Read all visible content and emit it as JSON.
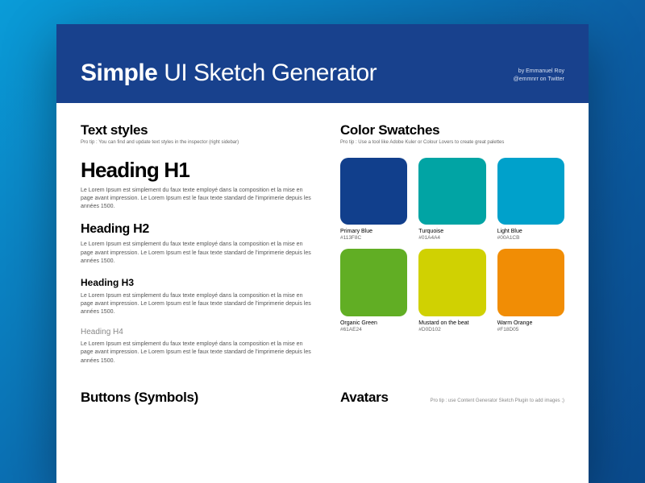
{
  "header": {
    "title_bold": "Simple",
    "title_rest": " UI Sketch Generator",
    "credit_line1": "by Emmanuel Roy",
    "credit_line2": "@emmnrr on Twitter"
  },
  "text_styles": {
    "title": "Text styles",
    "protip": "Pro tip : You can find and update text styles in the inspector (right sidebar)",
    "h1": "Heading H1",
    "h2": "Heading H2",
    "h3": "Heading H3",
    "h4": "Heading H4",
    "body": "Le Lorem Ipsum est simplement du faux texte employé dans la composition et la mise en page avant impression. Le Lorem Ipsum est le faux texte standard de l'imprimerie depuis les années 1500."
  },
  "color_swatches": {
    "title": "Color Swatches",
    "protip": "Pro tip : Use a tool like Adobe Kuler or Colour Lovers to create great palettes",
    "items": [
      {
        "name": "Primary Blue",
        "hex": "#113F8C"
      },
      {
        "name": "Turquoise",
        "hex": "#01A4A4"
      },
      {
        "name": "Light Blue",
        "hex": "#00A1CB"
      },
      {
        "name": "Organic Green",
        "hex": "#61AE24"
      },
      {
        "name": "Mustard on the beat",
        "hex": "#D0D102"
      },
      {
        "name": "Warm Orange",
        "hex": "#F18D05"
      }
    ]
  },
  "buttons_section": {
    "title": "Buttons (Symbols)"
  },
  "avatars_section": {
    "title": "Avatars",
    "protip": "Pro tip : use Content Generator Sketch Plugin to add images ;)"
  }
}
